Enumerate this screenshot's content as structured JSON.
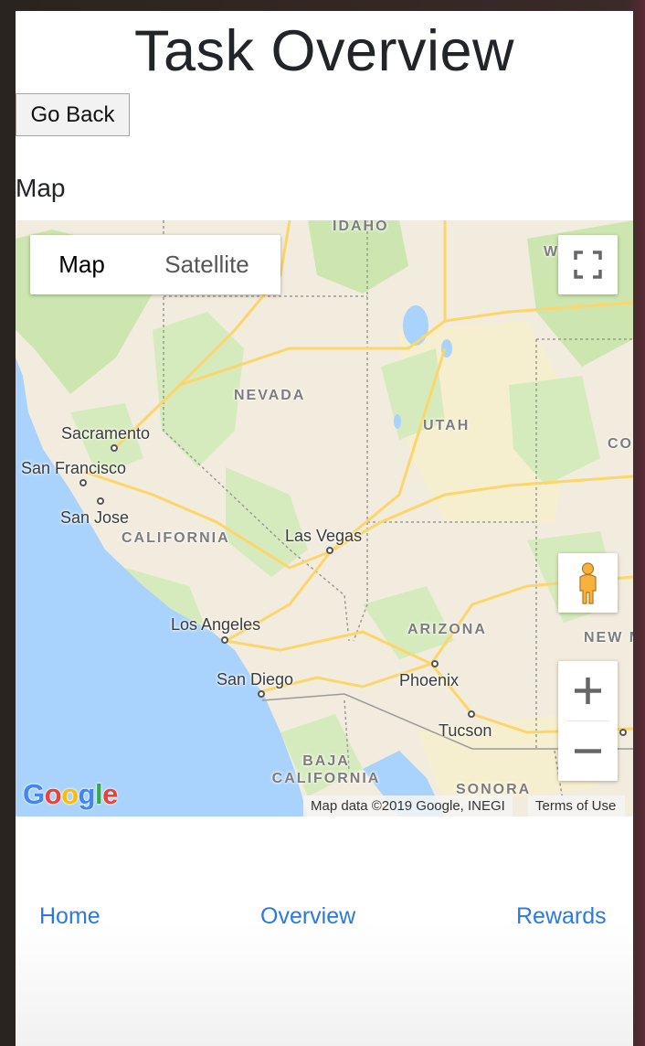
{
  "page": {
    "title": "Task Overview",
    "back_button_label": "Go Back",
    "section_label": "Map"
  },
  "map": {
    "type_control": {
      "options": [
        "Map",
        "Satellite"
      ],
      "selected": "Map"
    },
    "regions": [
      "IDAHO",
      "NEVADA",
      "UTAH",
      "CALIFORNIA",
      "ARIZONA",
      "BAJA CALIFORNIA",
      "SONORA",
      "NEW M",
      "CO",
      "W"
    ],
    "cities": [
      "Sacramento",
      "San Francisco",
      "San Jose",
      "Las Vegas",
      "Los Angeles",
      "San Diego",
      "Phoenix",
      "Tucson"
    ],
    "logo": "Google",
    "attribution": "Map data ©2019 Google, INEGI",
    "terms": "Terms of Use",
    "controls": {
      "fullscreen_icon": "fullscreen-icon",
      "pegman_icon": "pegman-icon",
      "zoom_in_icon": "plus-icon",
      "zoom_out_icon": "minus-icon"
    },
    "colors": {
      "water": "#a9d3fd",
      "land": "#f1ecdd",
      "park": "#cde6b0",
      "highway": "#fcd56b"
    }
  },
  "nav": {
    "items": [
      "Home",
      "Overview",
      "Rewards"
    ],
    "color": "#2a7ae2"
  }
}
